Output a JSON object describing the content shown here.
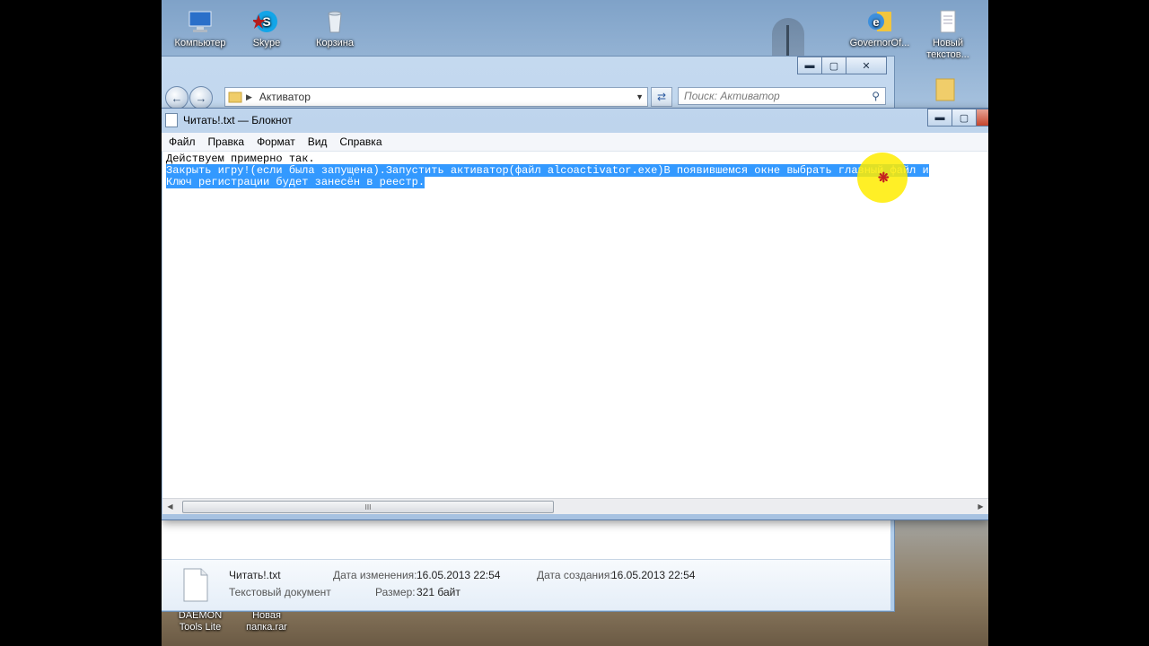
{
  "desktop": {
    "icons": [
      {
        "label": "Компьютер",
        "icon": "computer-icon"
      },
      {
        "label": "Skype",
        "icon": "skype-icon"
      },
      {
        "label": "Корзина",
        "icon": "recycle-bin-icon"
      },
      {
        "label": "GovernorOf...",
        "icon": "ie-shortcut-icon"
      },
      {
        "label": "Новый текстов...",
        "icon": "text-file-icon"
      },
      {
        "label": "DAEMON Tools Lite",
        "icon": "daemon-tools-icon"
      },
      {
        "label": "Новая папка.rar",
        "icon": "rar-archive-icon"
      }
    ]
  },
  "explorer": {
    "address": "Активатор",
    "search_placeholder": "Поиск: Активатор",
    "details": {
      "file_name": "Читать!.txt",
      "file_type": "Текстовый документ",
      "modified_label": "Дата изменения:",
      "modified_value": "16.05.2013 22:54",
      "created_label": "Дата создания:",
      "created_value": "16.05.2013 22:54",
      "size_label": "Размер:",
      "size_value": "321 байт"
    }
  },
  "notepad": {
    "title": "Читать!.txt — Блокнот",
    "menu": [
      "Файл",
      "Правка",
      "Формат",
      "Вид",
      "Справка"
    ],
    "lines": [
      "Действуем примерно так.",
      "Закрыть игру!(если была запущена).Запустить активатор(файл alcoactivator.exe)В появившемся окне выбрать главный файл и",
      "Ключ регистрации будет занесён в реестр."
    ],
    "selected_lines": [
      1,
      2
    ],
    "scroll_thumb_glyph": "III"
  },
  "window_controls": {
    "minimize": "▬",
    "maximize": "▢",
    "close": "✕"
  }
}
